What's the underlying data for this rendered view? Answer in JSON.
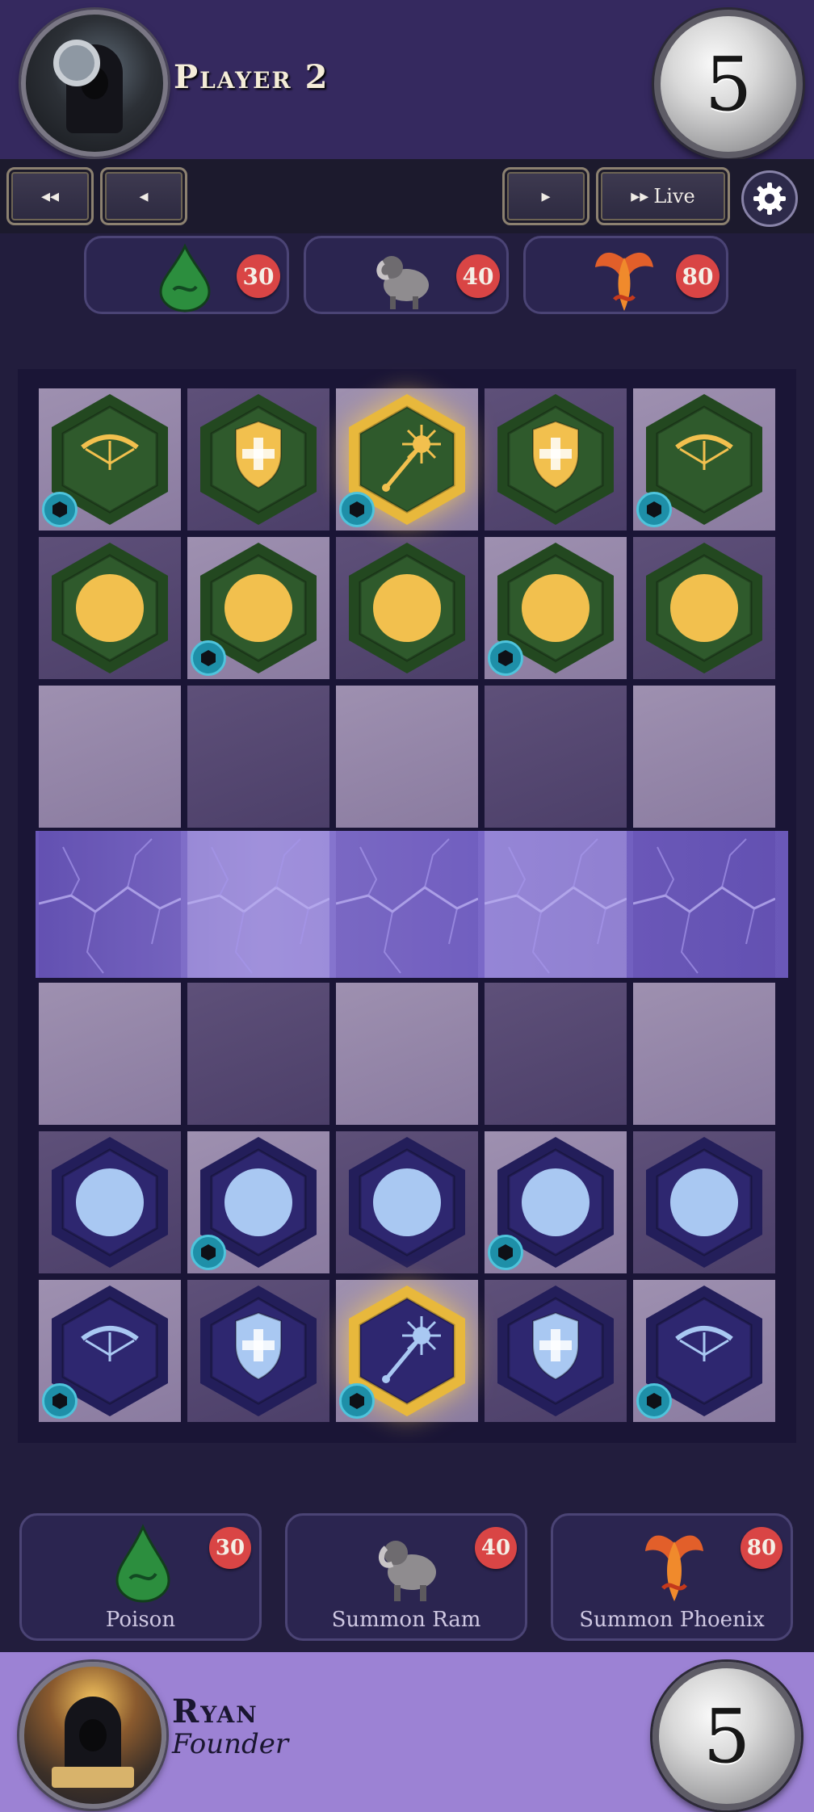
{
  "opponent": {
    "name": "Player 2",
    "score": "5"
  },
  "player": {
    "name": "Ryan",
    "title": "Founder",
    "score": "5"
  },
  "playback": {
    "rewind_label": "◂◂",
    "back_label": "◂",
    "forward_label": "▸",
    "live_icon": "▸▸",
    "live_label": "Live"
  },
  "opponent_spells": [
    {
      "icon": "poison-drop-icon",
      "cost": "30"
    },
    {
      "icon": "ram-icon",
      "cost": "40"
    },
    {
      "icon": "phoenix-icon",
      "cost": "80"
    }
  ],
  "player_spells": [
    {
      "icon": "poison-drop-icon",
      "cost": "30",
      "name": "Poison"
    },
    {
      "icon": "ram-icon",
      "cost": "40",
      "name": "Summon Ram"
    },
    {
      "icon": "phoenix-icon",
      "cost": "80",
      "name": "Summon Phoenix"
    }
  ],
  "board": {
    "columns": 5,
    "rows": 7,
    "river_row": 3,
    "pieces": [
      {
        "row": 0,
        "col": 0,
        "side": "opponent",
        "type": "bow-icon",
        "pearl": true
      },
      {
        "row": 0,
        "col": 1,
        "side": "opponent",
        "type": "shield-icon",
        "pearl": false
      },
      {
        "row": 0,
        "col": 2,
        "side": "opponent",
        "type": "wand-icon",
        "pearl": true,
        "highlight": true
      },
      {
        "row": 0,
        "col": 3,
        "side": "opponent",
        "type": "shield-icon",
        "pearl": false
      },
      {
        "row": 0,
        "col": 4,
        "side": "opponent",
        "type": "bow-icon",
        "pearl": true
      },
      {
        "row": 1,
        "col": 0,
        "side": "opponent",
        "type": "pawn-icon",
        "pearl": false
      },
      {
        "row": 1,
        "col": 1,
        "side": "opponent",
        "type": "pawn-icon",
        "pearl": true
      },
      {
        "row": 1,
        "col": 2,
        "side": "opponent",
        "type": "pawn-icon",
        "pearl": false
      },
      {
        "row": 1,
        "col": 3,
        "side": "opponent",
        "type": "pawn-icon",
        "pearl": true
      },
      {
        "row": 1,
        "col": 4,
        "side": "opponent",
        "type": "pawn-icon",
        "pearl": false
      },
      {
        "row": 5,
        "col": 0,
        "side": "player",
        "type": "pawn-icon",
        "pearl": false
      },
      {
        "row": 5,
        "col": 1,
        "side": "player",
        "type": "pawn-icon",
        "pearl": true
      },
      {
        "row": 5,
        "col": 2,
        "side": "player",
        "type": "pawn-icon",
        "pearl": false
      },
      {
        "row": 5,
        "col": 3,
        "side": "player",
        "type": "pawn-icon",
        "pearl": true
      },
      {
        "row": 5,
        "col": 4,
        "side": "player",
        "type": "pawn-icon",
        "pearl": false
      },
      {
        "row": 6,
        "col": 0,
        "side": "player",
        "type": "bow-icon",
        "pearl": true
      },
      {
        "row": 6,
        "col": 1,
        "side": "player",
        "type": "shield-icon",
        "pearl": false
      },
      {
        "row": 6,
        "col": 2,
        "side": "player",
        "type": "wand-icon",
        "pearl": true,
        "highlight": true
      },
      {
        "row": 6,
        "col": 3,
        "side": "player",
        "type": "shield-icon",
        "pearl": false
      },
      {
        "row": 6,
        "col": 4,
        "side": "player",
        "type": "bow-icon",
        "pearl": true
      }
    ]
  },
  "colors": {
    "opponent_piece": "#2f5a2c",
    "opponent_emblem": "#f2c04e",
    "player_piece": "#2e2770",
    "player_emblem": "#a9c8f2",
    "highlight_rim": "#e8b83c",
    "cost_badge": "#d94545",
    "player_bar": "#9c82d4"
  }
}
